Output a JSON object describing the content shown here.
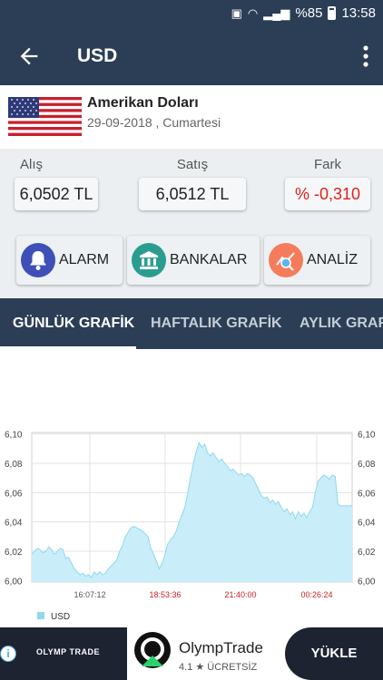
{
  "status_bar": {
    "battery": "%85",
    "time": "13:58"
  },
  "app_bar": {
    "title": "USD"
  },
  "currency": {
    "name": "Amerikan Doları",
    "date": "29-09-2018 , Cumartesi"
  },
  "rates": {
    "buy_label": "Alış",
    "buy_value": "6,0502 TL",
    "sell_label": "Satış",
    "sell_value": "6,0512 TL",
    "diff_label": "Fark",
    "diff_value": "% -0,310",
    "diff_color": "#e0201b"
  },
  "actions": {
    "alarm": "ALARM",
    "banks": "BANKALAR",
    "analysis": "ANALİZ"
  },
  "tabs": {
    "daily": "GÜNLÜK GRAFİK",
    "weekly": "HAFTALIK GRAFİK",
    "monthly": "AYLIK GRAFİK"
  },
  "chart_data": {
    "type": "area",
    "series": [
      {
        "name": "USD",
        "color": "#c9eef9",
        "line_color": "#8fd8ef"
      }
    ],
    "y_ticks": [
      "6,10",
      "6,08",
      "6,06",
      "6,04",
      "6,02",
      "6,00"
    ],
    "ylim": [
      5.999,
      6.101
    ],
    "x_ticks": [
      "16:07:12",
      "18:53:36",
      "21:40:00",
      "00:26:24"
    ],
    "x_tick_colors": [
      "#555555",
      "#cc2222",
      "#cc2222",
      "#cc2222"
    ],
    "y": [
      6.018,
      6.02,
      6.022,
      6.021,
      6.019,
      6.02,
      6.023,
      6.021,
      6.018,
      6.02,
      6.022,
      6.021,
      6.015,
      6.016,
      6.012,
      6.008,
      6.006,
      6.004,
      6.005,
      6.003,
      6.004,
      6.002,
      6.006,
      6.004,
      6.006,
      6.004,
      6.005,
      6.008,
      6.01,
      6.012,
      6.014,
      6.02,
      6.024,
      6.03,
      6.033,
      6.036,
      6.037,
      6.036,
      6.035,
      6.034,
      6.032,
      6.03,
      6.022,
      6.018,
      6.013,
      6.008,
      6.012,
      6.018,
      6.025,
      6.028,
      6.03,
      6.034,
      6.04,
      6.045,
      6.05,
      6.06,
      6.07,
      6.08,
      6.088,
      6.094,
      6.091,
      6.093,
      6.087,
      6.085,
      6.087,
      6.084,
      6.081,
      6.083,
      6.08,
      6.078,
      6.075,
      6.076,
      6.074,
      6.072,
      6.073,
      6.071,
      6.073,
      6.072,
      6.07,
      6.066,
      6.062,
      6.058,
      6.056,
      6.057,
      6.053,
      6.055,
      6.052,
      6.054,
      6.05,
      6.047,
      6.049,
      6.045,
      6.047,
      6.042,
      6.047,
      6.044,
      6.046,
      6.043,
      6.047,
      6.05,
      6.06,
      6.068,
      6.07,
      6.072,
      6.071,
      6.069,
      6.072,
      6.071,
      6.052,
      6.051,
      6.051,
      6.051,
      6.051,
      6.051
    ]
  },
  "ad": {
    "brand_small": "OLYMP TRADE",
    "title": "OlympTrade",
    "rating": "4.1 ★ ÜCRETSİZ",
    "cta": "YÜKLE",
    "info": "i"
  }
}
